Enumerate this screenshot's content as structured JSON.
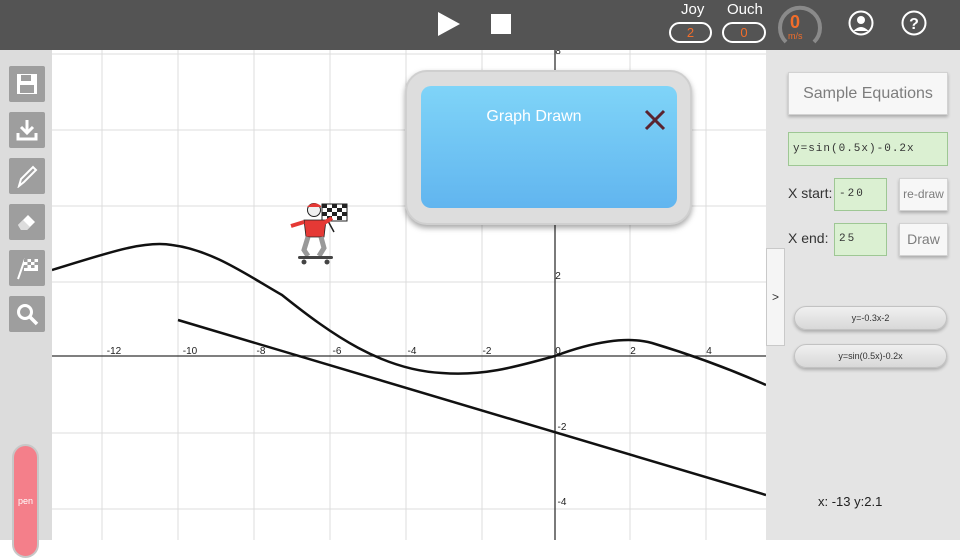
{
  "toolbar": {
    "play_icon": "play-icon",
    "stop_icon": "stop-icon",
    "joy_label": "Joy",
    "joy_value": "2",
    "ouch_label": "Ouch",
    "ouch_value": "0",
    "speed_value": "0",
    "speed_unit": "m/s",
    "user_icon": "user-icon",
    "help_icon": "help-icon",
    "accent_color": "#f26d2a"
  },
  "tools": [
    {
      "name": "save-icon"
    },
    {
      "name": "download-icon"
    },
    {
      "name": "pencil-icon"
    },
    {
      "name": "eraser-icon"
    },
    {
      "name": "finish-flag-icon"
    },
    {
      "name": "search-icon"
    }
  ],
  "pen_button": {
    "label": "pen",
    "color": "#f47f8a"
  },
  "graph": {
    "x_ticks": [
      "-12",
      "-10",
      "-8",
      "-6",
      "-4",
      "-2",
      "0",
      "2",
      "4"
    ],
    "y_ticks": [
      "8",
      "2",
      "-2",
      "-4"
    ],
    "curves": [
      "y=-0.3x-2",
      "y=sin(0.5x)-0.2x"
    ],
    "line_color": "#000000"
  },
  "dialog": {
    "title": "Graph Drawn",
    "close_icon": "close-icon"
  },
  "panel": {
    "toggle_label": ">",
    "sample_button": "Sample Equations",
    "equation": "y=sin(0.5x)-0.2x",
    "x_start_label": "X start:",
    "x_start_value": "-20",
    "redraw_button": "re-draw",
    "x_end_label": "X end:",
    "x_end_value": "25",
    "draw_button": "Draw",
    "history": [
      "y=-0.3x-2",
      "y=sin(0.5x)-0.2x"
    ],
    "coords": "x: -13  y:2.1"
  }
}
